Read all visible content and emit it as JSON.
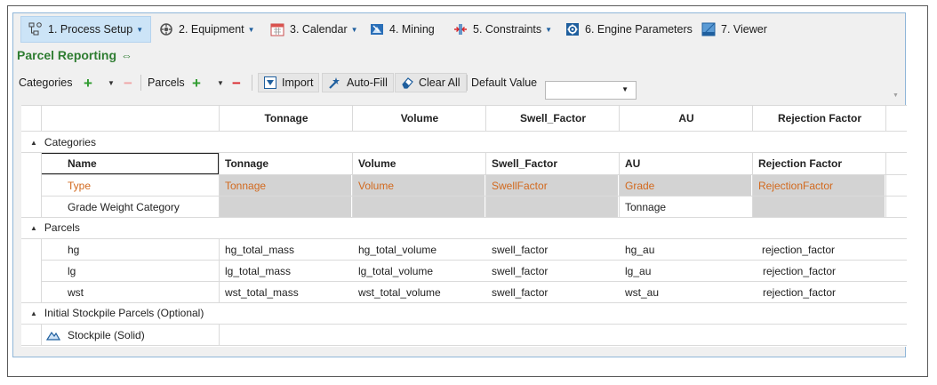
{
  "tabs": [
    {
      "label": "1. Process Setup",
      "icon": "process-flow-icon",
      "dropdown": true,
      "active": true
    },
    {
      "label": "2. Equipment",
      "icon": "equipment-icon",
      "dropdown": true
    },
    {
      "label": "3. Calendar",
      "icon": "calendar-icon",
      "dropdown": true
    },
    {
      "label": "4. Mining",
      "icon": "mining-icon",
      "dropdown": false
    },
    {
      "label": "5. Constraints",
      "icon": "constraints-icon",
      "dropdown": true
    },
    {
      "label": "6. Engine Parameters",
      "icon": "engine-gear-icon",
      "dropdown": false
    },
    {
      "label": "7. Viewer",
      "icon": "viewer-icon",
      "dropdown": false
    }
  ],
  "title": "Parcel Reporting",
  "toolbar": {
    "categories_label": "Categories",
    "parcels_label": "Parcels",
    "import_label": "Import",
    "autofill_label": "Auto-Fill",
    "clear_label": "Clear All",
    "default_value_label": "Default Value",
    "default_value": ""
  },
  "grid": {
    "columns": [
      "Tonnage",
      "Volume",
      "Swell_Factor",
      "AU",
      "Rejection Factor"
    ],
    "categories_group": "Categories",
    "categories_header": {
      "name": "Name",
      "cols": [
        "Tonnage",
        "Volume",
        "Swell_Factor",
        "AU",
        "Rejection Factor"
      ]
    },
    "type_row": {
      "name": "Type",
      "cols": [
        "Tonnage",
        "Volume",
        "SwellFactor",
        "Grade",
        "RejectionFactor"
      ]
    },
    "grade_weight_row": {
      "name": "Grade Weight Category",
      "au": "Tonnage"
    },
    "parcels_group": "Parcels",
    "parcels": [
      {
        "name": "hg",
        "cols": [
          "hg_total_mass",
          "hg_total_volume",
          "swell_factor",
          "hg_au",
          "rejection_factor"
        ]
      },
      {
        "name": "lg",
        "cols": [
          "lg_total_mass",
          "lg_total_volume",
          "swell_factor",
          "lg_au",
          "rejection_factor"
        ]
      },
      {
        "name": "wst",
        "cols": [
          "wst_total_mass",
          "wst_total_volume",
          "swell_factor",
          "wst_au",
          "rejection_factor"
        ]
      }
    ],
    "stockpile_group": "Initial Stockpile Parcels (Optional)",
    "stockpile_item": "Stockpile (Solid)"
  },
  "colors": {
    "accent": "#2f7d32",
    "active_tab": "#cce4f7",
    "type_text": "#d2691e",
    "readonly_cell": "#d3d3d3"
  }
}
